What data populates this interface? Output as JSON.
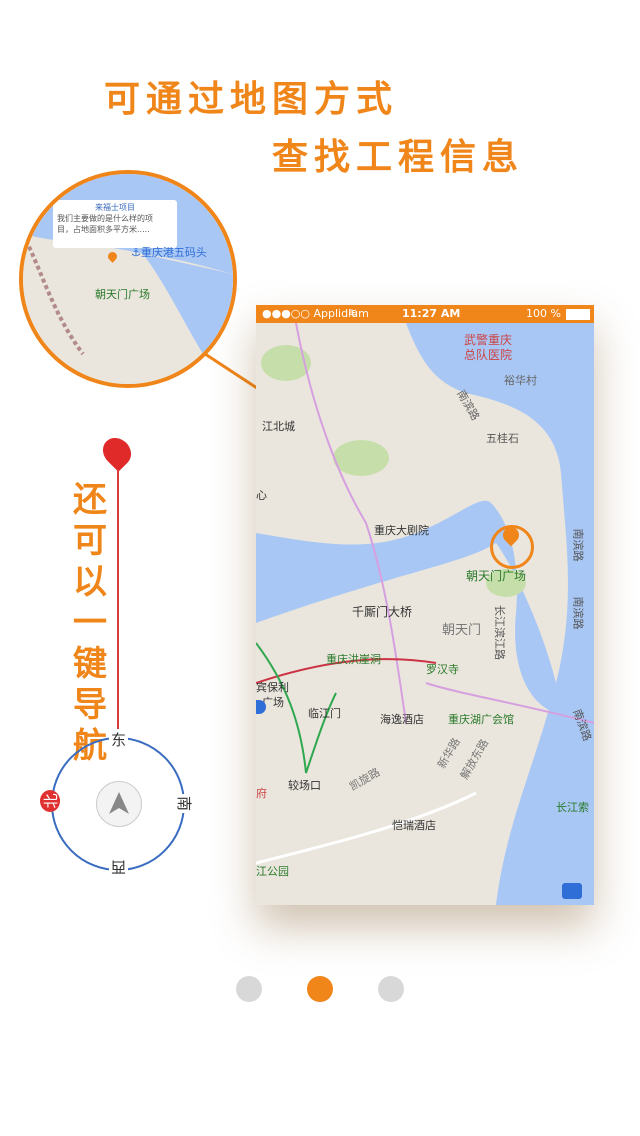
{
  "headline": {
    "line1": "可通过地图方式",
    "line2": "查找工程信息"
  },
  "status_bar": {
    "carrier": "●●●○○ Applidium",
    "time": "11:27 AM",
    "battery": "100 %"
  },
  "map_labels": {
    "wujing": "武警重庆",
    "zongdui": "总队医院",
    "yuhuacun": "裕华村",
    "nanbinlu1": "南滨路",
    "wuguishi": "五桂石",
    "jiangbeicheng": "江北城",
    "xin": "心",
    "grand_theatre": "重庆大剧院",
    "nanbinlu2": "南滨路",
    "nanbinlu3": "南滨路",
    "chaotianmen_square": "朝天门广场",
    "qiansimen_bridge": "千厮门大桥",
    "chaotianmen": "朝天门",
    "changjiang_binjiang": "长江滨江路",
    "hongyadong": "重庆洪崖洞",
    "luohan_temple": "罗汉寺",
    "baoli": "宾保利",
    "guangchang": "广场",
    "linjiangmen": "临江门",
    "haiyi_hotel": "海逸酒店",
    "chongqing_hu_guangchang": "重庆湖广会馆",
    "jiaochangkou": "较场口",
    "kaixuanlu": "凯旋路",
    "xinhua_road": "新华路",
    "jiefangdong": "解放东路",
    "nanbinlu4": "南滨路",
    "fu": "府",
    "changjiang_cable": "长江索",
    "kairui_hotel": "恺瑞酒店",
    "jiang_park": "江公园"
  },
  "zoom": {
    "popup_title": "来福士项目",
    "popup_line1": "我们主要做的是什么样的项",
    "popup_line2": "目，占地面积多平方米.....",
    "pier": "重庆港五码头",
    "square": "朝天门广场"
  },
  "navigation": {
    "title": "还可以一键导航"
  },
  "compass": {
    "east": "东",
    "south": "南",
    "west": "西",
    "north": "北"
  },
  "pagination": {
    "count": 3,
    "active_index": 1
  }
}
